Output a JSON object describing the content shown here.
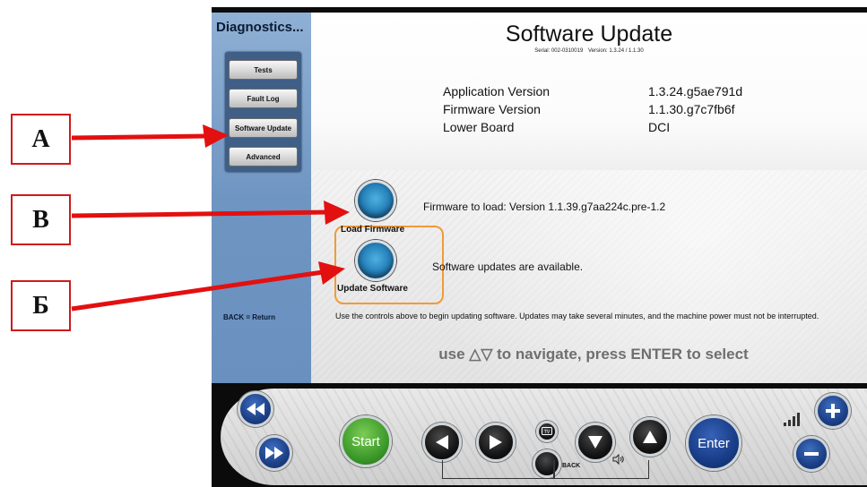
{
  "sidebar": {
    "title": "Diagnostics...",
    "items": [
      {
        "label": "Tests"
      },
      {
        "label": "Fault Log"
      },
      {
        "label": "Software Update"
      },
      {
        "label": "Advanced"
      }
    ],
    "footer": "BACK = Return"
  },
  "main": {
    "title": "Software Update",
    "serial_label": "Serial: 002-0310019",
    "version_label": "Version: 1.3.24 / 1.1.30",
    "info": [
      {
        "label": "Application Version",
        "value": "1.3.24.g5ae791d"
      },
      {
        "label": "Firmware Version",
        "value": "1.1.30.g7c7fb6f"
      },
      {
        "label": "Lower Board",
        "value": "DCI"
      }
    ],
    "load_firmware": {
      "label": "Load Firmware",
      "message": "Firmware to load: Version 1.1.39.g7aa224c.pre-1.2"
    },
    "update_software": {
      "label": "Update Software",
      "message": "Software updates are available."
    },
    "help_text": "Use the controls above to begin updating software.  Updates may take several minutes, and the machine power must not be interrupted.",
    "nav_hint": "use △▽ to navigate, press ENTER to select"
  },
  "controls": {
    "start_label": "Start",
    "enter_label": "Enter",
    "back_label": "BACK"
  },
  "callouts": {
    "a": "A",
    "b": "B",
    "v": "Б"
  },
  "colors": {
    "sidebar_blue": "#6f95c2",
    "callout_red": "#e31010",
    "start_green": "#3c9a2a",
    "enter_blue": "#183c86",
    "bracket_orange": "#f29a38"
  }
}
